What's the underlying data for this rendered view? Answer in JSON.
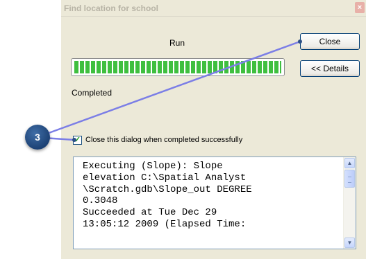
{
  "dialog": {
    "title": "Find location for school",
    "close_glyph": "×",
    "run_label": "Run",
    "progress": 1.0,
    "status_label": "Completed",
    "close_button": "Close",
    "details_button": "<< Details",
    "checkbox_label": "Close this dialog when completed successfully",
    "checkbox_checked": true,
    "log_text": "Executing (Slope): Slope\nelevation C:\\Spatial Analyst\n\\Scratch.gdb\\Slope_out DEGREE\n0.3048\nSucceeded at Tue Dec 29\n13:05:12 2009 (Elapsed Time:"
  },
  "callout": {
    "number": "3"
  },
  "colors": {
    "callout_fill": "#2b5589",
    "leader_line": "#7b7ee6",
    "progress_green": "#3fbf3f",
    "dialog_bg": "#ece9d8"
  },
  "icons": {
    "checkbox": "check-icon",
    "scroll_up": "chevron-up-icon",
    "scroll_down": "chevron-down-icon"
  }
}
